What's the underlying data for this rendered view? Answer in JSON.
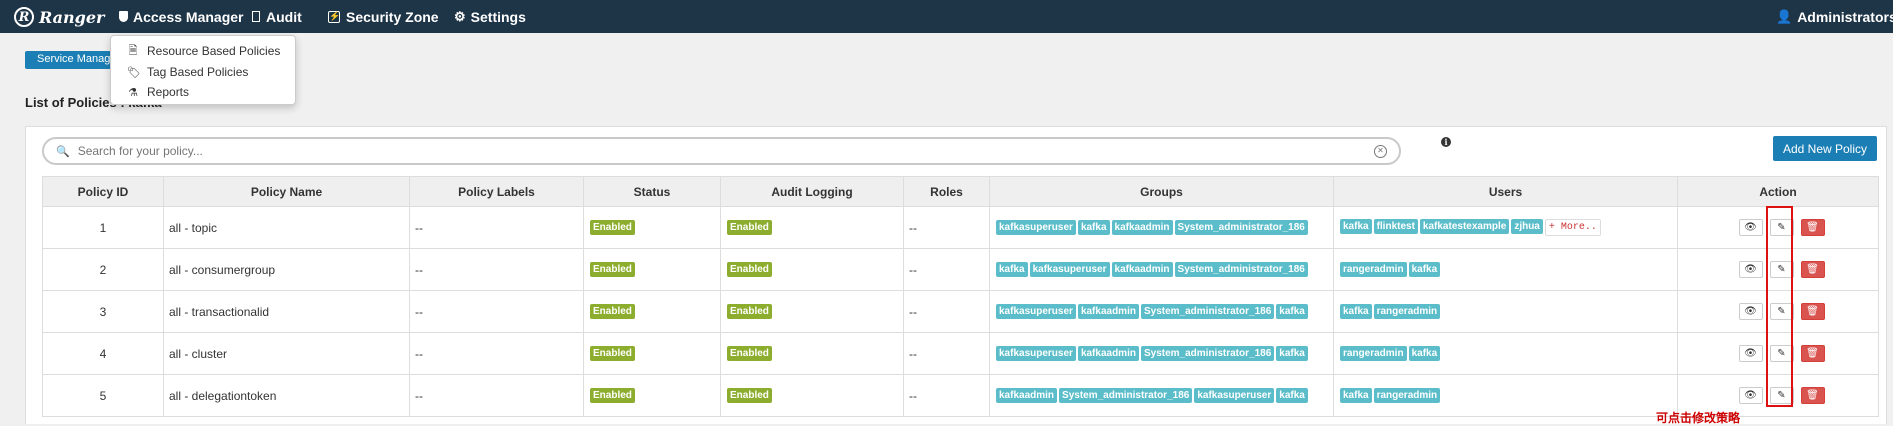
{
  "nav": {
    "brand": "Ranger",
    "access_manager": "Access Manager",
    "audit": "Audit",
    "security_zone": "Security Zone",
    "settings": "Settings",
    "user": "Administrators"
  },
  "dropdown": {
    "items": [
      "Resource Based Policies",
      "Tag Based Policies",
      "Reports"
    ]
  },
  "breadcrumb": {
    "service_manager": "Service Manager"
  },
  "list_title": "List of Policies : kafka",
  "search": {
    "placeholder": "Search for your policy..."
  },
  "add_button": "Add New Policy",
  "columns": [
    "Policy ID",
    "Policy Name",
    "Policy Labels",
    "Status",
    "Audit Logging",
    "Roles",
    "Groups",
    "Users",
    "Action"
  ],
  "rows": [
    {
      "id": "1",
      "name": "all - topic",
      "labels": "--",
      "status": "Enabled",
      "audit": "Enabled",
      "roles": "--",
      "groups": [
        "kafkasuperuser",
        "kafka",
        "kafkaadmin",
        "System_administrator_186"
      ],
      "users": [
        "kafka",
        "flinktest",
        "kafkatestexample",
        "zjhua"
      ],
      "more": "+ More.."
    },
    {
      "id": "2",
      "name": "all - consumergroup",
      "labels": "--",
      "status": "Enabled",
      "audit": "Enabled",
      "roles": "--",
      "groups": [
        "kafka",
        "kafkasuperuser",
        "kafkaadmin",
        "System_administrator_186"
      ],
      "users": [
        "rangeradmin",
        "kafka"
      ]
    },
    {
      "id": "3",
      "name": "all - transactionalid",
      "labels": "--",
      "status": "Enabled",
      "audit": "Enabled",
      "roles": "--",
      "groups": [
        "kafkasuperuser",
        "kafkaadmin",
        "System_administrator_186",
        "kafka"
      ],
      "users": [
        "kafka",
        "rangeradmin"
      ]
    },
    {
      "id": "4",
      "name": "all - cluster",
      "labels": "--",
      "status": "Enabled",
      "audit": "Enabled",
      "roles": "--",
      "groups": [
        "kafkasuperuser",
        "kafkaadmin",
        "System_administrator_186",
        "kafka"
      ],
      "users": [
        "rangeradmin",
        "kafka"
      ]
    },
    {
      "id": "5",
      "name": "all - delegationtoken",
      "labels": "--",
      "status": "Enabled",
      "audit": "Enabled",
      "roles": "--",
      "groups": [
        "kafkaadmin",
        "System_administrator_186",
        "kafkasuperuser",
        "kafka"
      ],
      "users": [
        "kafka",
        "rangeradmin"
      ]
    }
  ],
  "annotation": "可点击修改策略",
  "colors": {
    "navbar": "#1e3447",
    "primary": "#1b7fb5",
    "enabled": "#8cad2d",
    "tag": "#5bbdc9",
    "delete": "#d9534f",
    "highlight": "#dd1111"
  },
  "icons": [
    "shield-icon",
    "document-icon",
    "security-zone-icon",
    "gear-icon",
    "user-icon",
    "search-icon",
    "clear-icon",
    "info-icon",
    "eye-icon",
    "edit-icon",
    "trash-icon"
  ]
}
